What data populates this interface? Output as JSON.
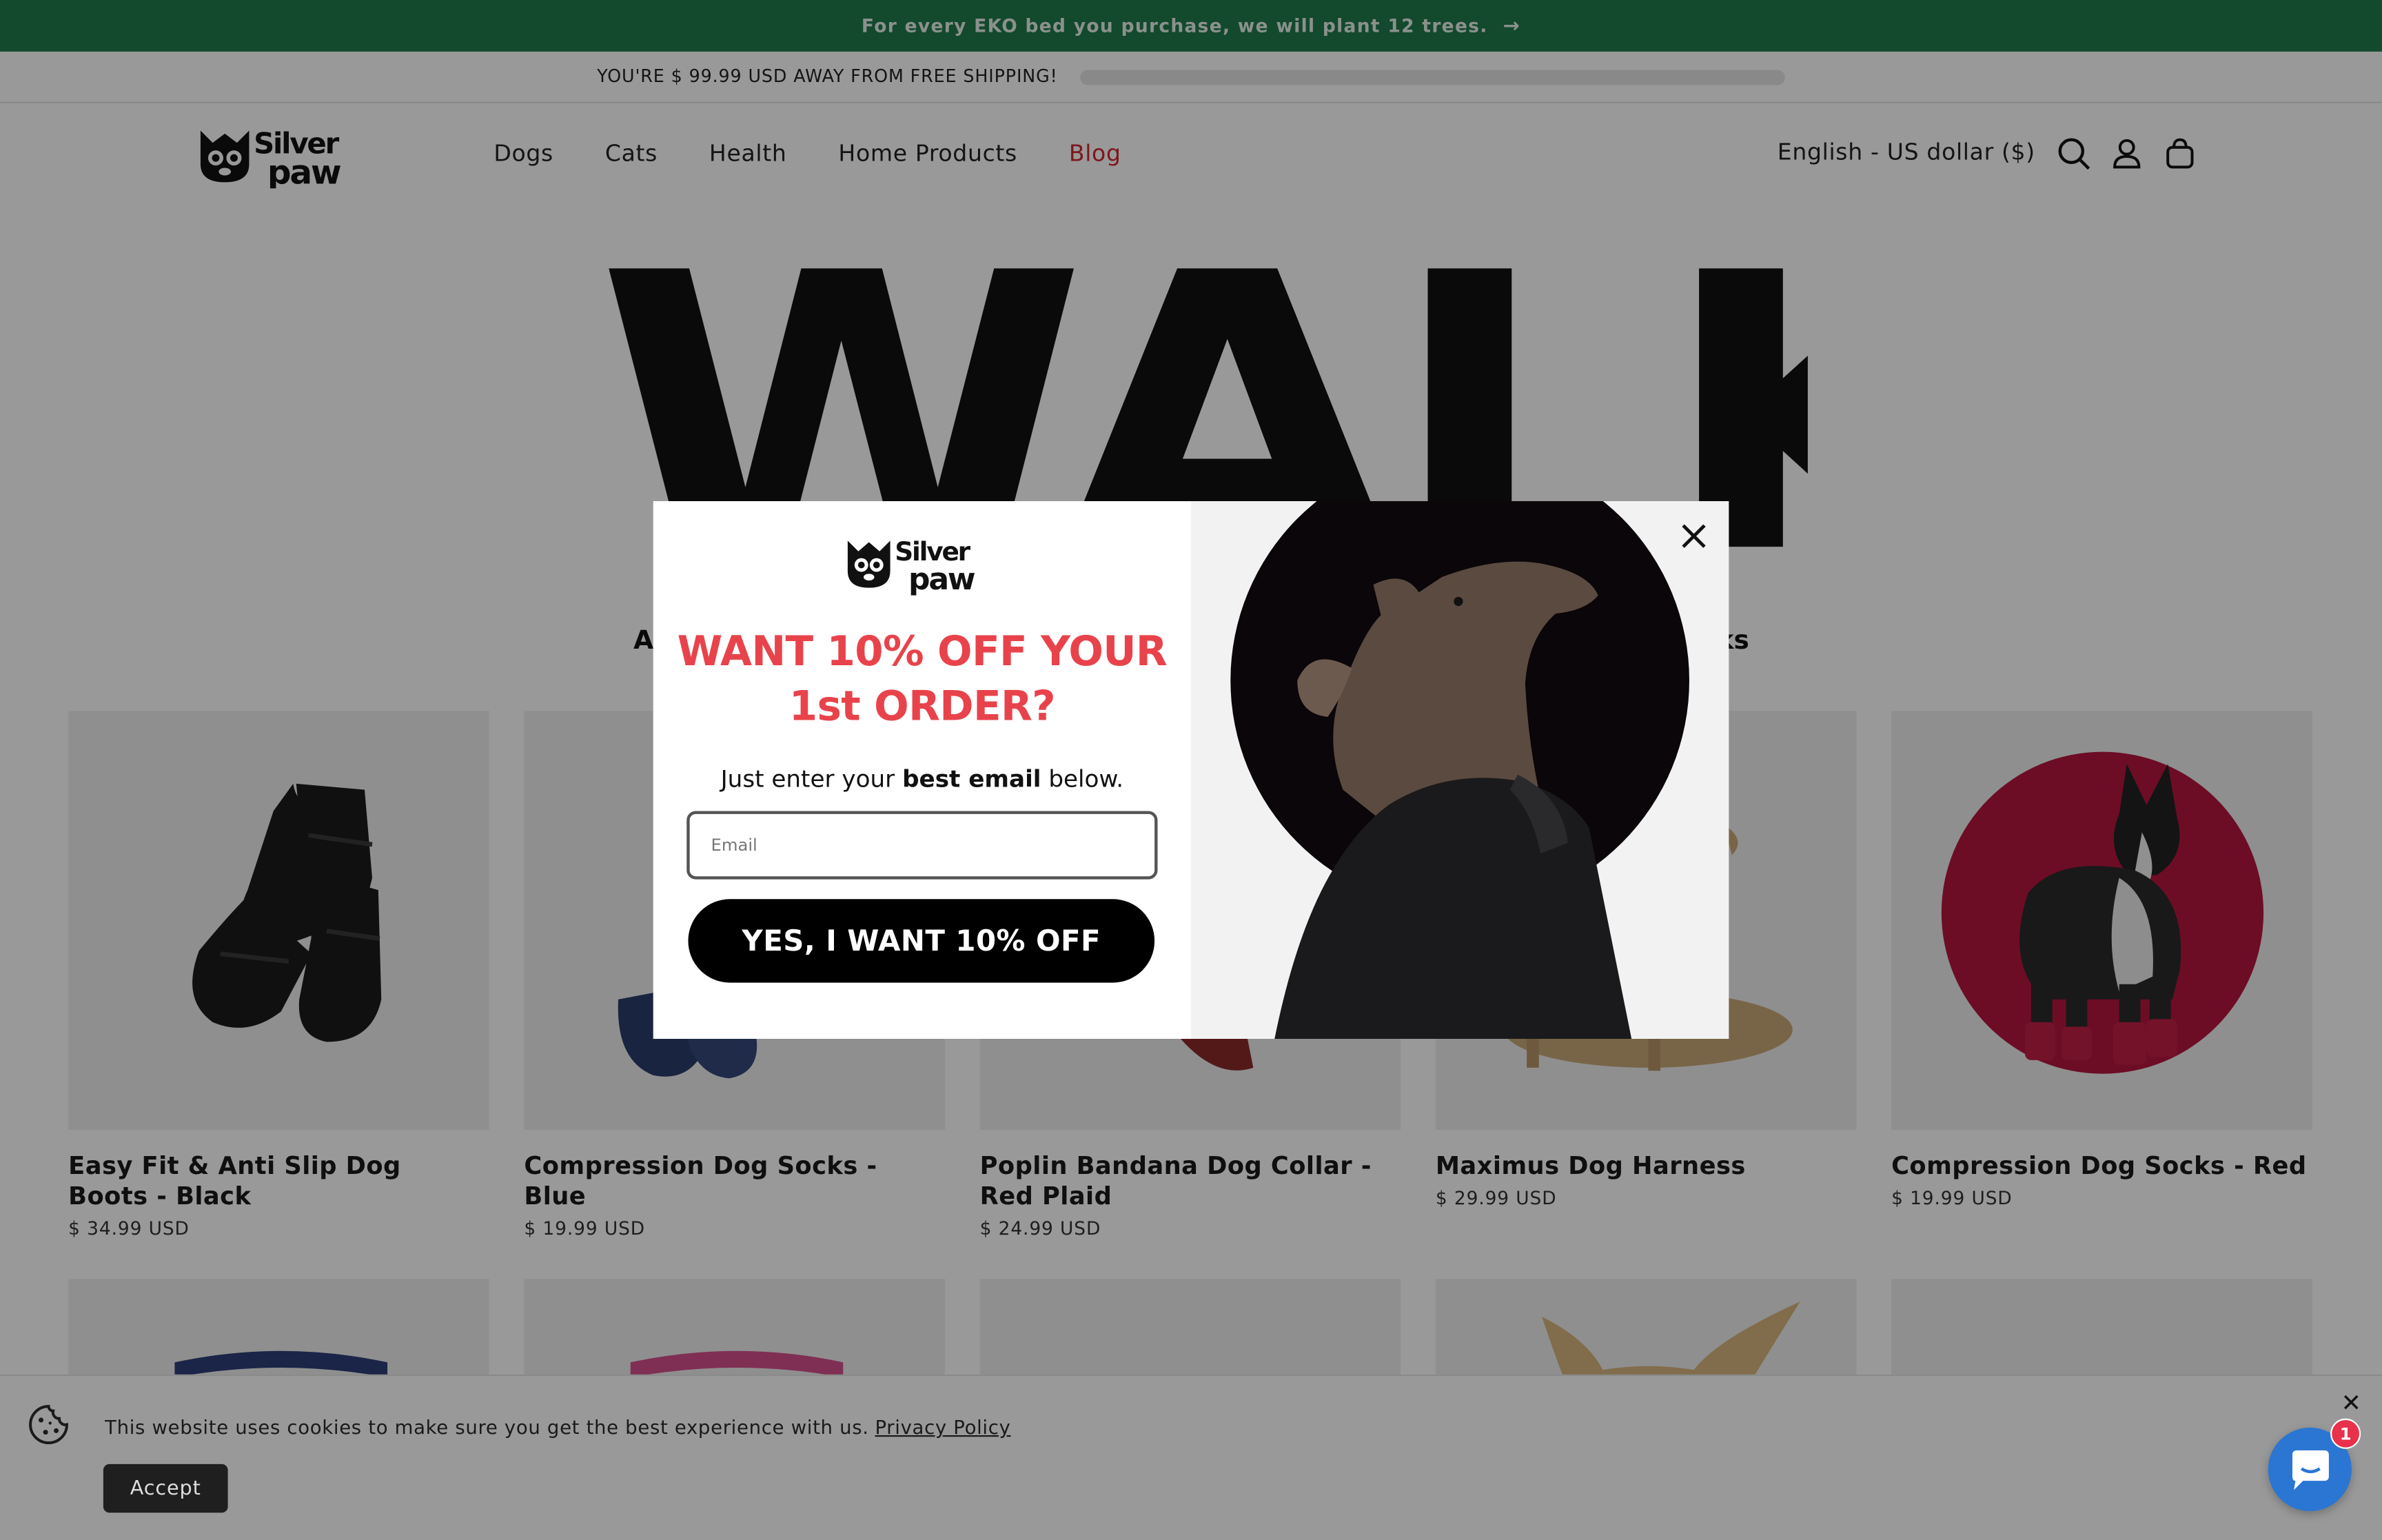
{
  "announcement": {
    "text": "For every EKO bed you purchase, we will plant 12 trees.",
    "arrow": "→"
  },
  "shipping": {
    "text": "YOU'RE $ 99.99 USD AWAY FROM FREE SHIPPING!",
    "progress_fraction": 0.0
  },
  "header": {
    "logo_alt": "Silver paw",
    "nav": [
      {
        "label": "Dogs"
      },
      {
        "label": "Cats"
      },
      {
        "label": "Health"
      },
      {
        "label": "Home Products"
      },
      {
        "label": "Blog"
      }
    ],
    "locale": "English - US dollar ($)",
    "icons": [
      "search-icon",
      "account-icon",
      "cart-icon"
    ]
  },
  "hero": {
    "word": "WALK",
    "subhead_left": "A",
    "subhead_right": "ks"
  },
  "products": [
    {
      "name": "Easy Fit & Anti Slip Dog Boots - Black",
      "price": "$ 34.99 USD"
    },
    {
      "name": "Compression Dog Socks - Blue",
      "price": "$ 19.99 USD"
    },
    {
      "name": "Poplin Bandana Dog Collar - Red Plaid",
      "price": "$ 24.99 USD"
    },
    {
      "name": "Maximus Dog Harness",
      "price": "$ 29.99 USD"
    },
    {
      "name": "Compression Dog Socks - Red",
      "price": "$ 19.99 USD"
    }
  ],
  "popup": {
    "headline_line1": "WANT 10% OFF YOUR",
    "headline_line2": "1st ORDER?",
    "sub_before": "Just enter your ",
    "sub_bold": "best email",
    "sub_after": " below.",
    "email_placeholder": "Email",
    "cta": "YES, I WANT 10% OFF",
    "close": "×"
  },
  "cookie": {
    "text": "This website uses cookies to make sure you get the best experience with us.",
    "link": "Privacy Policy",
    "accept": "Accept",
    "close": "✕"
  },
  "chat": {
    "badge": "1"
  },
  "colors": {
    "announcement_bg": "#207a4c",
    "blog_link": "#d4252e",
    "headline": "#e8434b",
    "chat": "#2a76d2",
    "badge": "#e8314a",
    "accent_red": "#b5163e"
  }
}
